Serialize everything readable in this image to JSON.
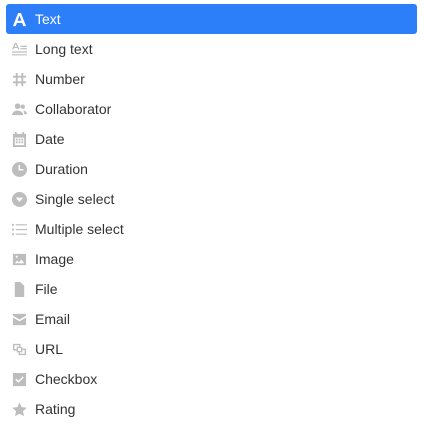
{
  "selected_index": 0,
  "accent_color": "#2d7ff9",
  "items": [
    {
      "label": "Text",
      "icon": "text-icon"
    },
    {
      "label": "Long text",
      "icon": "long-text-icon"
    },
    {
      "label": "Number",
      "icon": "hash-icon"
    },
    {
      "label": "Collaborator",
      "icon": "people-icon"
    },
    {
      "label": "Date",
      "icon": "calendar-icon"
    },
    {
      "label": "Duration",
      "icon": "clock-icon"
    },
    {
      "label": "Single select",
      "icon": "chevron-circle-icon"
    },
    {
      "label": "Multiple select",
      "icon": "list-icon"
    },
    {
      "label": "Image",
      "icon": "image-icon"
    },
    {
      "label": "File",
      "icon": "file-icon"
    },
    {
      "label": "Email",
      "icon": "envelope-icon"
    },
    {
      "label": "URL",
      "icon": "link-icon"
    },
    {
      "label": "Checkbox",
      "icon": "checkbox-icon"
    },
    {
      "label": "Rating",
      "icon": "star-icon"
    }
  ]
}
